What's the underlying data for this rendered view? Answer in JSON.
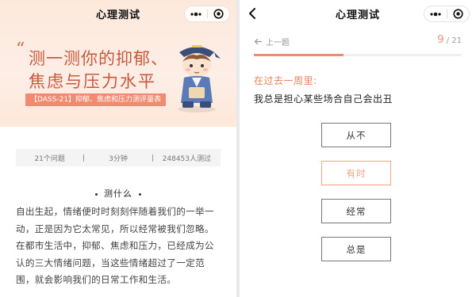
{
  "left_screen": {
    "nav": {
      "title": "心理测试",
      "menu_icon": "more-dots-icon",
      "close_icon": "target-close-icon"
    },
    "banner": {
      "quote_mark": "“",
      "title_line1": "测一测你的抑郁、",
      "title_line2": "焦虑与压力水平",
      "tag": "【DASS-21】抑郁、焦虑和压力测评量表",
      "mascot_icon": "scholar-boy-illustration"
    },
    "stats": [
      {
        "label": "21个问题"
      },
      {
        "label": "3分钟"
      },
      {
        "label": "248453人测过"
      }
    ],
    "section_title": "测什么",
    "intro_lines": [
      "自出生起，情绪便时时刻刻伴随着我们的一举一",
      "动，正是因为它太常见，所以经常被我们忽略。",
      "在都市生活中，抑郁、焦虑和压力，已经成为公",
      "认的三大情绪问题，当这些情绪超过了一定范",
      "围，就会影响我们的日常工作和生活。"
    ]
  },
  "right_screen": {
    "nav": {
      "title": "心理测试",
      "back_icon": "chevron-left-icon",
      "menu_icon": "more-dots-icon",
      "close_icon": "target-close-icon"
    },
    "prev_label": "上一题",
    "progress": {
      "current": "9",
      "separator": "/",
      "total": "21",
      "fraction": 0.43
    },
    "question_label": "在过去一周里:",
    "question_text": "我总是担心某些场合自己会出丑",
    "options": [
      {
        "label": "从不",
        "selected": false
      },
      {
        "label": "有时",
        "selected": true
      },
      {
        "label": "经常",
        "selected": false
      },
      {
        "label": "总是",
        "selected": false
      }
    ],
    "colors": {
      "accent": "#ec8f6e",
      "question_label": "#e5845e",
      "selected_border": "#f1a184",
      "banner_title": "#c9583c"
    }
  }
}
